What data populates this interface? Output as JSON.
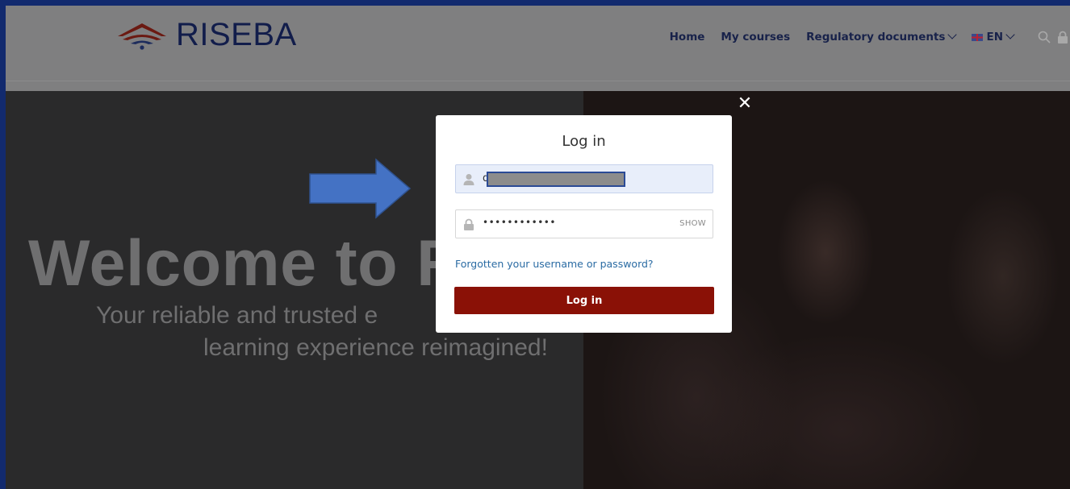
{
  "brand": {
    "name": "RISEBA"
  },
  "nav": {
    "home": "Home",
    "my_courses": "My courses",
    "regulatory": "Regulatory documents",
    "language": "EN"
  },
  "hero": {
    "welcome": "Welcome to RISEBA!",
    "line1": "Your reliable and trusted e",
    "line2": "learning experience reimagined!"
  },
  "modal": {
    "title": "Log in",
    "username_value": "d",
    "password_value": "••••••••••••",
    "show_label": "SHOW",
    "forgot_link": "Forgotten your username or password?",
    "login_button": "Log in",
    "close_glyph": "✕"
  },
  "colors": {
    "header_bg": "#7f7f80",
    "frame_border": "#122a6e",
    "login_button": "#8a1106",
    "link": "#2a6ba3",
    "arrow": "#4472c4"
  }
}
